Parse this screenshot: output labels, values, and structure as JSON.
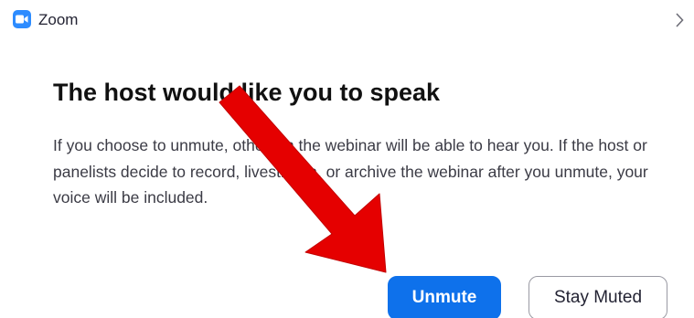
{
  "window": {
    "app_title": "Zoom",
    "app_icon": "zoom-camera-icon",
    "expand_icon": "chevron-right-icon"
  },
  "dialog": {
    "heading": "The host would like you to speak",
    "message": "If you choose to unmute, others in the webinar will be able to hear you. If the host or panelists decide to record, livestream, or archive the webinar after you unmute, your voice will be included.",
    "primary_button": "Unmute",
    "secondary_button": "Stay Muted"
  },
  "annotation": {
    "type": "arrow",
    "color": "#E50000",
    "points_to": "unmute-button"
  },
  "colors": {
    "brand": "#2D8CFF",
    "primary_button": "#0E71EB"
  }
}
